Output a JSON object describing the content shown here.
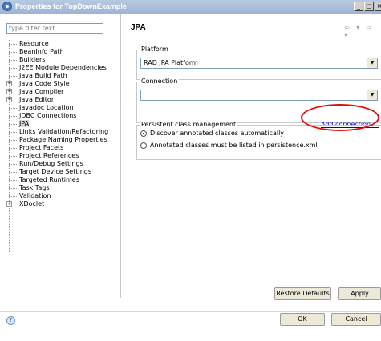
{
  "window": {
    "title": "Properties for TopDownExample",
    "min_label": "_",
    "max_label": "□",
    "close_label": "×"
  },
  "filter": {
    "placeholder": "type filter text"
  },
  "tree": {
    "items": [
      {
        "label": "Resource",
        "expandable": false
      },
      {
        "label": "BeanInfo Path",
        "expandable": false
      },
      {
        "label": "Builders",
        "expandable": false
      },
      {
        "label": "J2EE Module Dependencies",
        "expandable": false
      },
      {
        "label": "Java Build Path",
        "expandable": false
      },
      {
        "label": "Java Code Style",
        "expandable": true
      },
      {
        "label": "Java Compiler",
        "expandable": true
      },
      {
        "label": "Java Editor",
        "expandable": true
      },
      {
        "label": "Javadoc Location",
        "expandable": false
      },
      {
        "label": "JDBC Connections",
        "expandable": false
      },
      {
        "label": "JPA",
        "expandable": false,
        "selected": true
      },
      {
        "label": "Links Validation/Refactoring",
        "expandable": false
      },
      {
        "label": "Package Naming Properties",
        "expandable": false
      },
      {
        "label": "Project Facets",
        "expandable": false
      },
      {
        "label": "Project References",
        "expandable": false
      },
      {
        "label": "Run/Debug Settings",
        "expandable": false
      },
      {
        "label": "Target Device Settings",
        "expandable": false
      },
      {
        "label": "Targeted Runtimes",
        "expandable": false
      },
      {
        "label": "Task Tags",
        "expandable": false
      },
      {
        "label": "Validation",
        "expandable": false
      },
      {
        "label": "XDoclet",
        "expandable": true
      }
    ]
  },
  "page": {
    "heading": "JPA",
    "nav_arrows": "⇦ ▾ ⇨ ▾"
  },
  "platform": {
    "legend": "Platform",
    "value": "RAD JPA Platform"
  },
  "connection": {
    "legend": "Connection",
    "value": "",
    "add_link": "Add connection ..."
  },
  "persistence": {
    "legend": "Persistent class management",
    "option1": "Discover annotated classes automatically",
    "option2": "Annotated classes must be listed in persistence.xml",
    "selected": 1
  },
  "buttons": {
    "restore_defaults": "Restore Defaults",
    "apply": "Apply",
    "ok": "OK",
    "cancel": "Cancel"
  },
  "help": {
    "label": "?"
  },
  "colors": {
    "annotation_circle": "#e01010",
    "link": "#0000cc"
  }
}
